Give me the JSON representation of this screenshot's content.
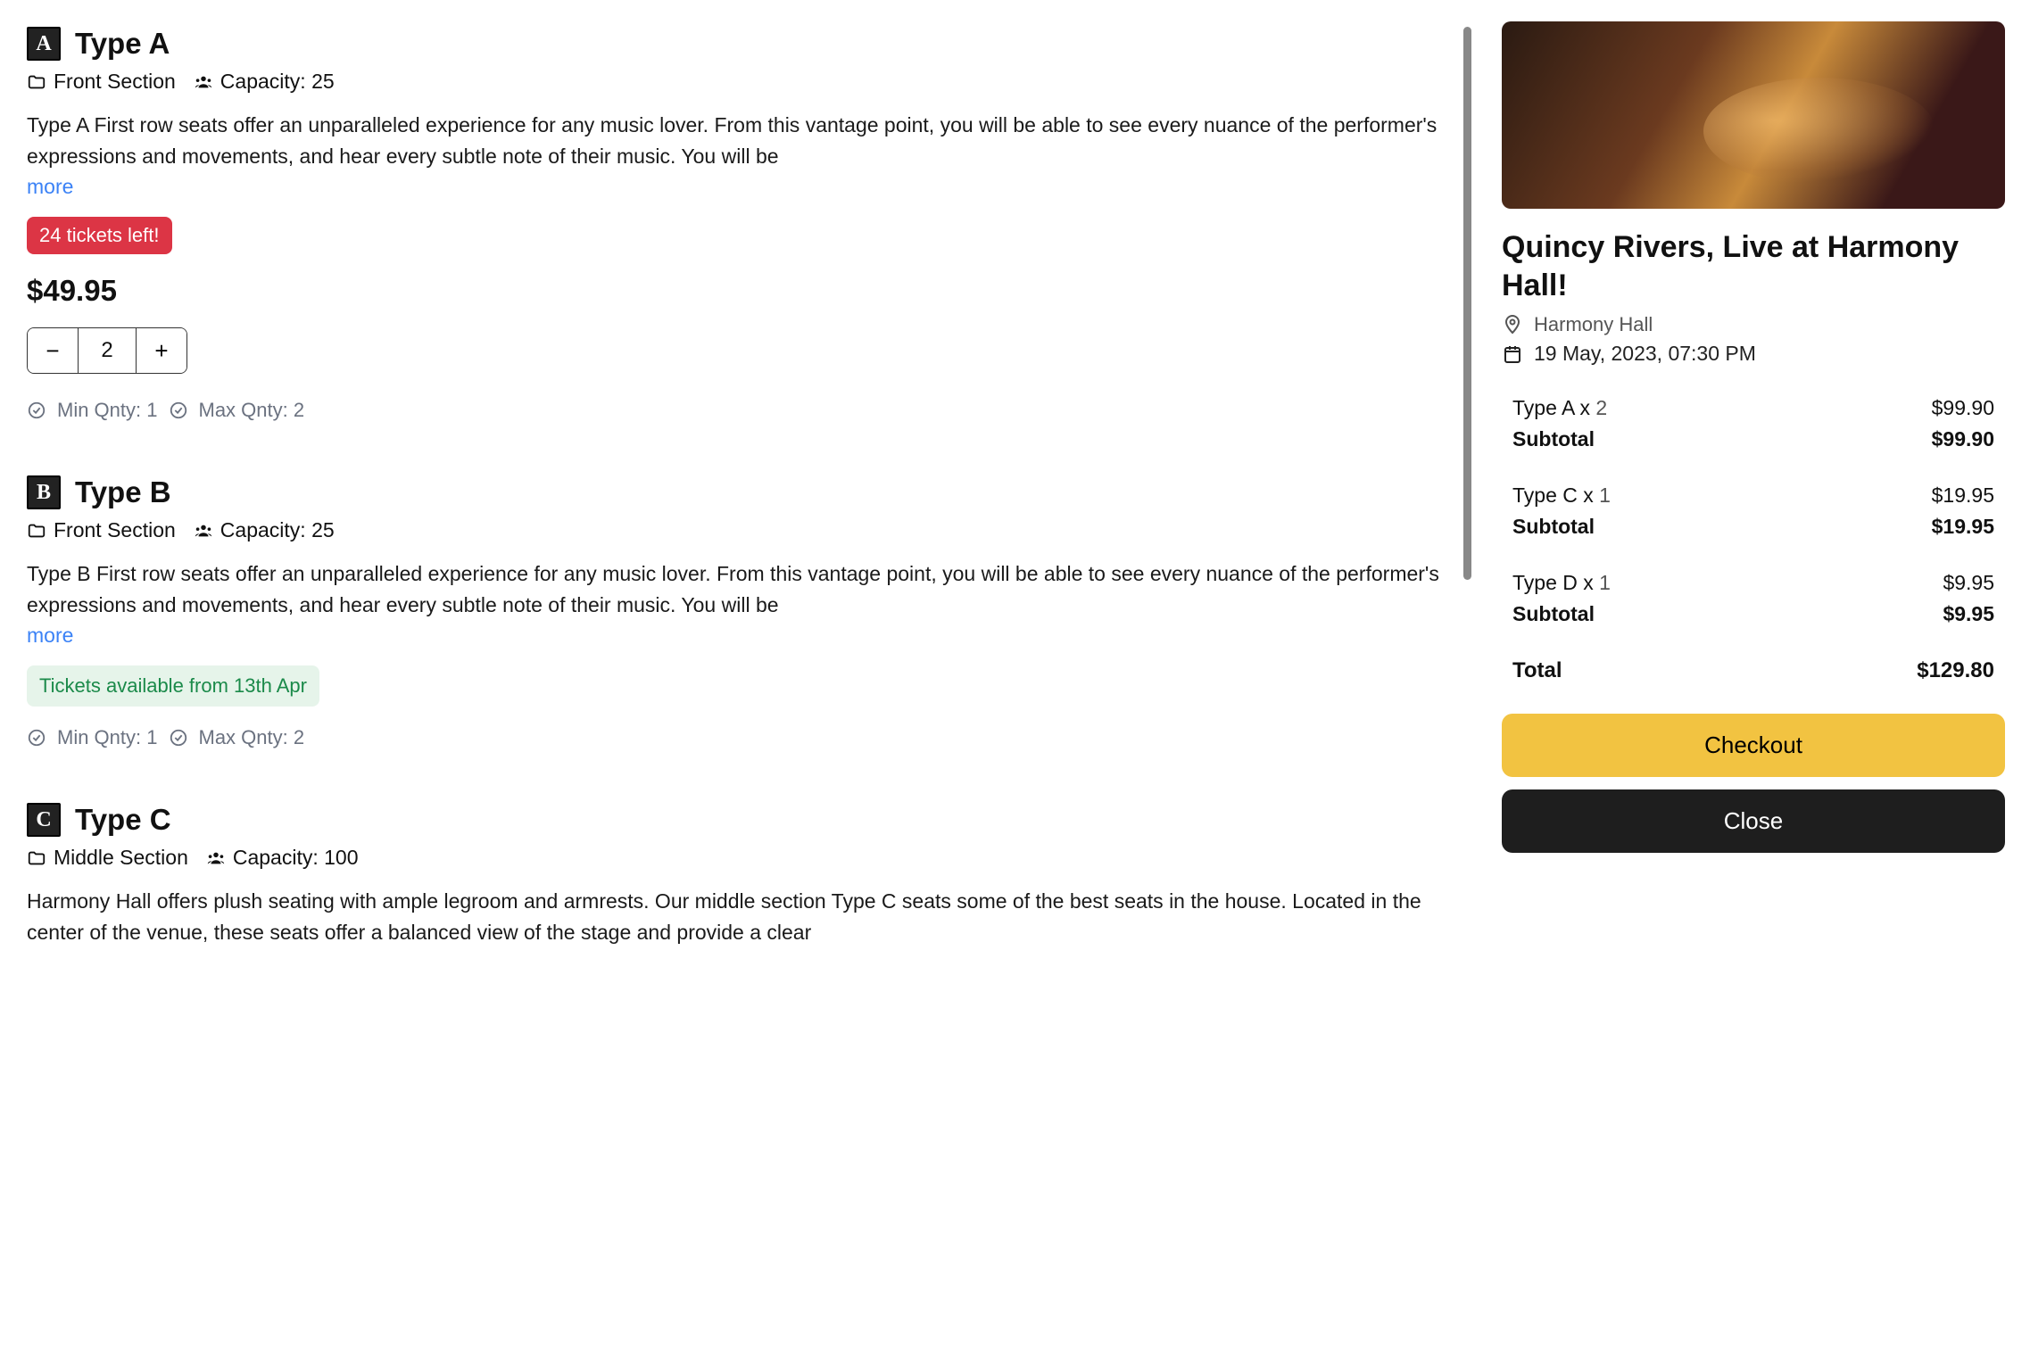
{
  "labels": {
    "more": "more",
    "min_qnty_prefix": "Min Qnty: ",
    "max_qnty_prefix": "Max Qnty: ",
    "capacity_prefix": "Capacity: ",
    "subtotal": "Subtotal",
    "total": "Total",
    "checkout": "Checkout",
    "close": "Close"
  },
  "event": {
    "title": "Quincy Rivers, Live at Harmony Hall!",
    "venue": "Harmony Hall",
    "datetime": "19 May, 2023, 07:30 PM"
  },
  "tickets": [
    {
      "badge": "A",
      "name": "Type A",
      "section": "Front Section",
      "capacity": "25",
      "description": "Type A First row seats offer an unparalleled experience for any music lover. From this vantage point, you will be able to see every nuance of the performer's expressions and movements, and hear every subtle note of their music. You will be",
      "availability_pill": "24 tickets left!",
      "price": "$49.95",
      "qty": "2",
      "min_qnty": "1",
      "max_qnty": "2"
    },
    {
      "badge": "B",
      "name": "Type B",
      "section": "Front Section",
      "capacity": "25",
      "description": "Type B First row seats offer an unparalleled experience for any music lover. From this vantage point, you will be able to see every nuance of the performer's expressions and movements, and hear every subtle note of their music. You will be",
      "upcoming_pill": "Tickets available from 13th Apr",
      "min_qnty": "1",
      "max_qnty": "2"
    },
    {
      "badge": "C",
      "name": "Type C",
      "section": "Middle Section",
      "capacity": "100",
      "description": "Harmony Hall offers plush seating with ample legroom and armrests. Our middle section Type C seats some of the best seats in the house. Located in the center of the venue, these seats offer a balanced view of the stage and provide a clear"
    }
  ],
  "cart": {
    "items": [
      {
        "label": "Type A x ",
        "qty": "2",
        "amount": "$99.90",
        "subtotal": "$99.90"
      },
      {
        "label": "Type C x ",
        "qty": "1",
        "amount": "$19.95",
        "subtotal": "$19.95"
      },
      {
        "label": "Type D x ",
        "qty": "1",
        "amount": "$9.95",
        "subtotal": "$9.95"
      }
    ],
    "total": "$129.80"
  }
}
